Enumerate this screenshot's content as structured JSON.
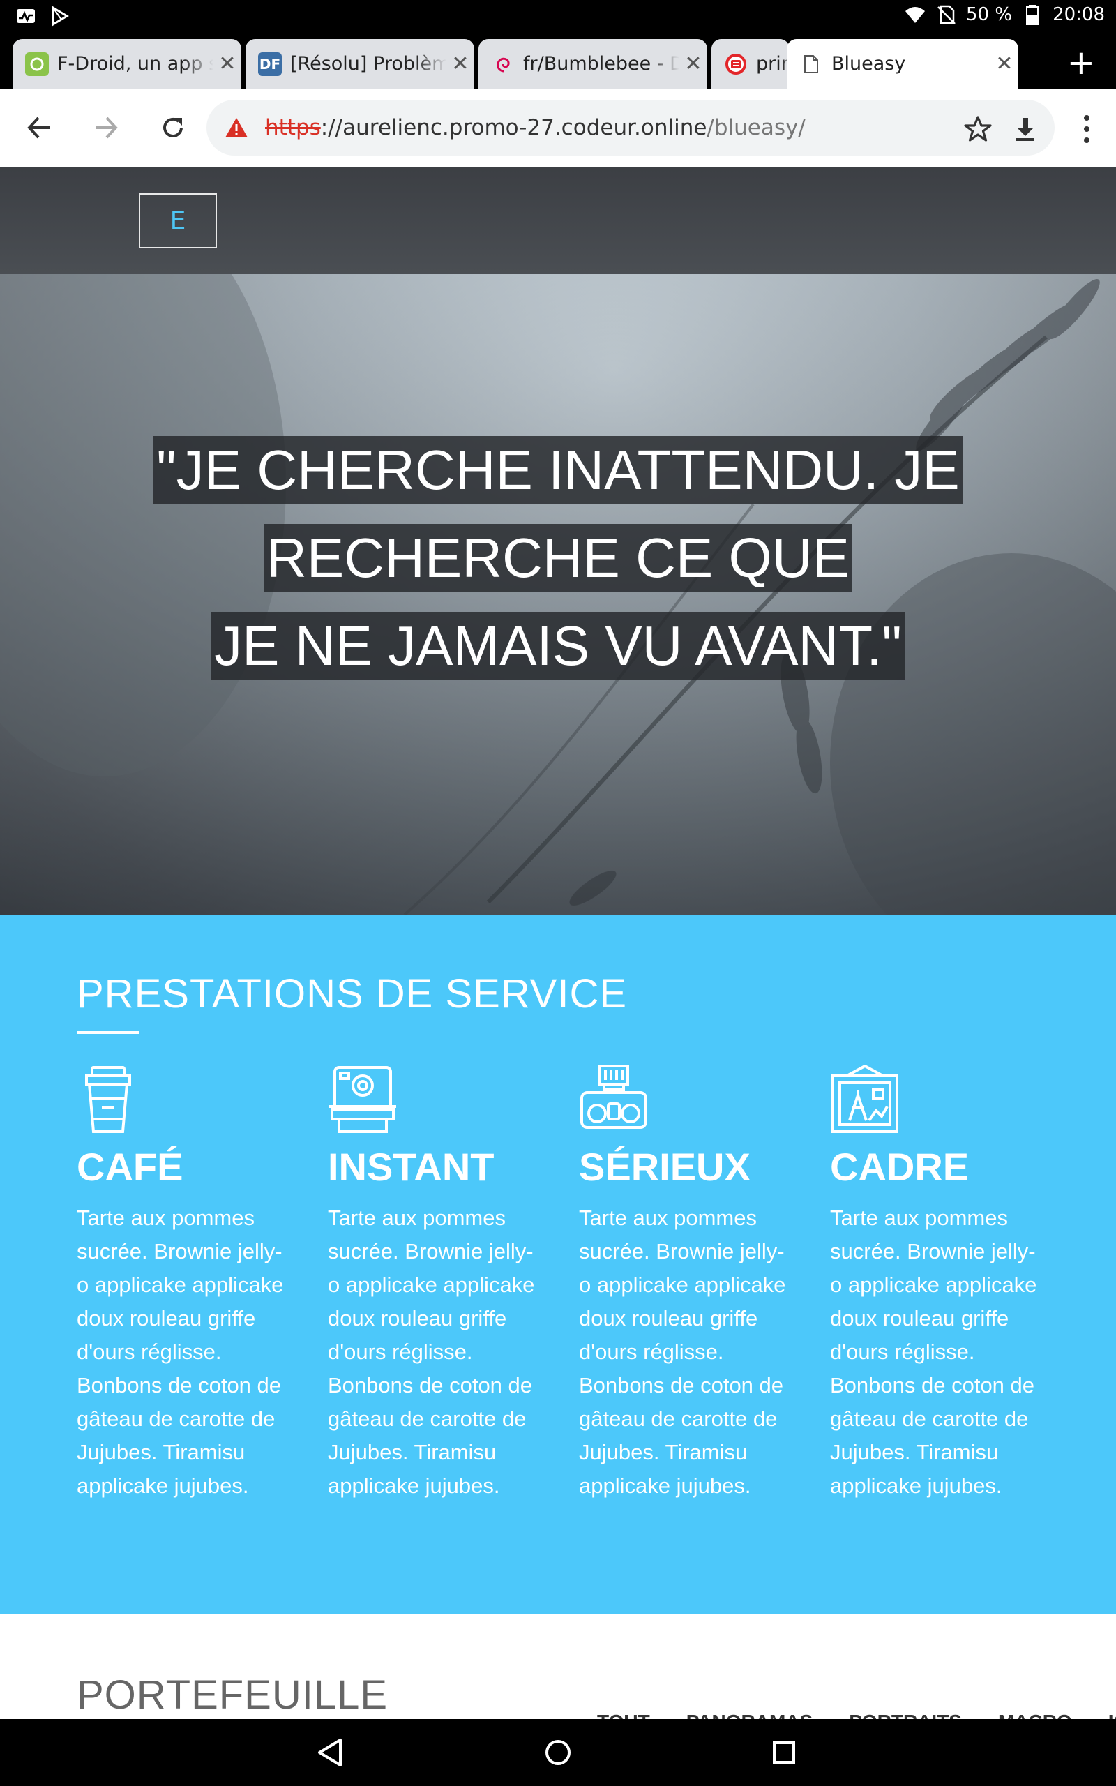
{
  "status_bar": {
    "battery": "50 %",
    "time": "20:08"
  },
  "tabs": [
    {
      "title": "F-Droid, un app s",
      "favicon_color": "#8bc34a",
      "favicon_text": ""
    },
    {
      "title": "[Résolu] Problèm",
      "favicon_color": "#3b6ea5",
      "favicon_text": "DF"
    },
    {
      "title": "fr/Bumblebee - D",
      "favicon_color": "#ffffff",
      "favicon_text": ""
    },
    {
      "title": "prin",
      "favicon_color": "#ffffff",
      "favicon_text": ""
    },
    {
      "title": "Blueasy",
      "favicon_color": "#ffffff",
      "favicon_text": ""
    }
  ],
  "address_bar": {
    "scheme": "https",
    "host": "://aurelienc.promo-27.codeur.online",
    "path": "/blueasy/"
  },
  "site": {
    "logo_letter": "E",
    "quote_lines": [
      "\"JE CHERCHE INATTENDU. JE",
      "RECHERCHE CE QUE",
      "JE NE JAMAIS VU AVANT.\""
    ],
    "services_title": "PRESTATIONS DE SERVICE",
    "services": [
      {
        "icon": "coffee-cup-icon",
        "title": "CAFÉ",
        "text": "Tarte aux pommes sucrée. Brownie jelly-o applicake applicake doux rouleau griffe d'ours réglisse. Bonbons de coton de gâteau de carotte de Jujubes. Tiramisu applicake jujubes."
      },
      {
        "icon": "instant-camera-icon",
        "title": "INSTANT",
        "text": "Tarte aux pommes sucrée. Brownie jelly-o applicake applicake doux rouleau griffe d'ours réglisse. Bonbons de coton de gâteau de carotte de Jujubes. Tiramisu applicake jujubes."
      },
      {
        "icon": "film-camera-icon",
        "title": "SÉRIEUX",
        "text": "Tarte aux pommes sucrée. Brownie jelly-o applicake applicake doux rouleau griffe d'ours réglisse. Bonbons de coton de gâteau de carotte de Jujubes. Tiramisu applicake jujubes."
      },
      {
        "icon": "picture-frame-icon",
        "title": "CADRE",
        "text": "Tarte aux pommes sucrée. Brownie jelly-o applicake applicake doux rouleau griffe d'ours réglisse. Bonbons de coton de gâteau de carotte de Jujubes. Tiramisu applicake jujubes."
      }
    ],
    "portfolio_title": "PORTEFEUILLE",
    "portfolio_filters": [
      "TOUT",
      "PANORAMAS",
      "PORTRAITS",
      "MACRO",
      "IO"
    ]
  },
  "colors": {
    "services_bg": "#4cc8fa",
    "logo_accent": "#4ec6f5",
    "insecure_red": "#d93025"
  }
}
